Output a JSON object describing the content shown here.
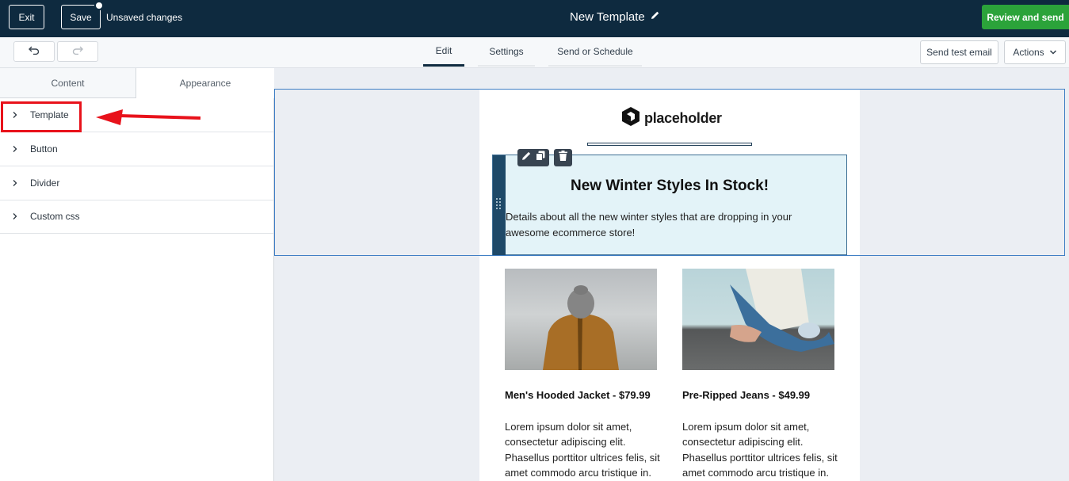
{
  "topbar": {
    "exit_label": "Exit",
    "save_label": "Save",
    "status": "Unsaved changes",
    "title": "New Template",
    "review_label": "Review and send"
  },
  "subbar": {
    "tabs": [
      "Edit",
      "Settings",
      "Send or Schedule"
    ],
    "send_test_label": "Send test email",
    "actions_label": "Actions"
  },
  "panel": {
    "tabs": [
      "Content",
      "Appearance"
    ],
    "items": [
      "Template",
      "Button",
      "Divider",
      "Custom css"
    ]
  },
  "email": {
    "logo_text": "placeholder",
    "heading": "New Winter Styles In Stock!",
    "body": "Details about all the new winter styles that are dropping in your awesome ecommerce store!",
    "products": [
      {
        "title": "Men's Hooded Jacket - $79.99",
        "desc": "Lorem ipsum dolor sit amet, consectetur adipiscing elit. Phasellus porttitor ultrices felis, sit amet commodo arcu tristique in."
      },
      {
        "title": "Pre-Ripped Jeans - $49.99",
        "desc": "Lorem ipsum dolor sit amet, consectetur adipiscing elit. Phasellus porttitor ultrices felis, sit amet commodo arcu tristique in."
      }
    ]
  },
  "colors": {
    "topbar_bg": "#0e2a3f",
    "primary_green": "#2ba33a",
    "annotation_red": "#e8121b",
    "selection_blue": "#3f7ec4"
  },
  "icons": [
    "pencil-icon",
    "undo-icon",
    "redo-icon",
    "chevron-down-icon",
    "chevron-right-icon",
    "copy-icon",
    "trash-icon",
    "drag-handle-icon",
    "logo-icon",
    "arrow-annotation"
  ]
}
